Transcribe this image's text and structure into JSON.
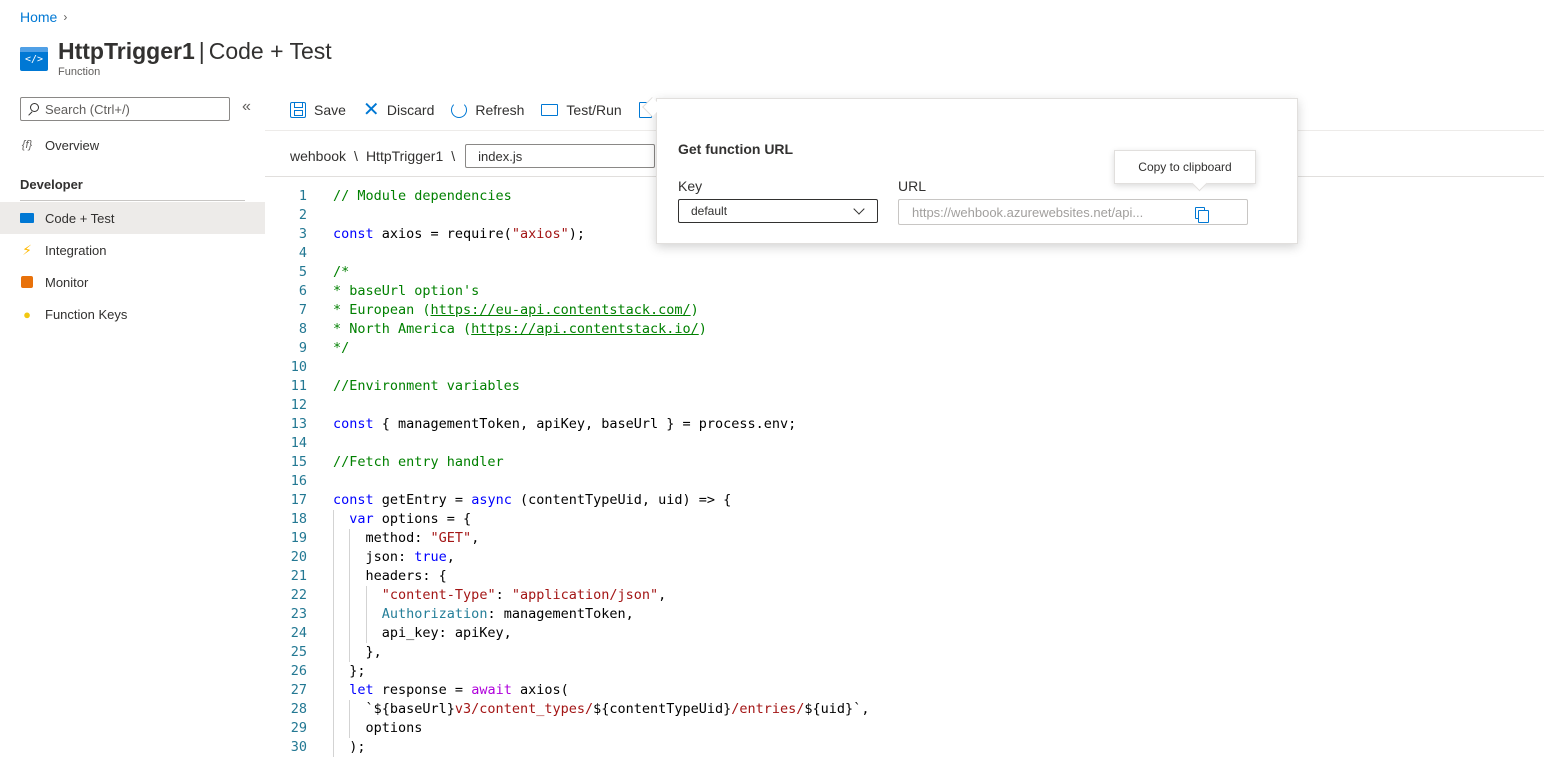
{
  "breadcrumb": {
    "home": "Home",
    "separator": "›"
  },
  "header": {
    "title": "HttpTrigger1",
    "separator": "|",
    "section": "Code + Test",
    "subtitle": "Function",
    "icon_text": "</>"
  },
  "sidebar": {
    "search_placeholder": "Search (Ctrl+/)",
    "collapse": "«",
    "overview": "Overview",
    "section": "Developer",
    "items": [
      {
        "label": "Code + Test",
        "icon": "code-icon"
      },
      {
        "label": "Integration",
        "icon": "lightning-icon"
      },
      {
        "label": "Monitor",
        "icon": "monitor-icon"
      },
      {
        "label": "Function Keys",
        "icon": "key-icon"
      }
    ]
  },
  "toolbar": {
    "save": "Save",
    "discard": "Discard",
    "refresh": "Refresh",
    "test_run": "Test/Run"
  },
  "path": {
    "app": "wehbook",
    "sep": "\\",
    "function": "HttpTrigger1",
    "file": "index.js"
  },
  "popup": {
    "title": "Get function URL",
    "key_label": "Key",
    "key_value": "default",
    "url_label": "URL",
    "url_value": "https://wehbook.azurewebsites.net/api..."
  },
  "tooltip": "Copy to clipboard",
  "colors": {
    "accent": "#0078d4",
    "comment": "#008000",
    "keyword": "#0000ff",
    "string": "#a31515",
    "control": "#af00db",
    "property": "#267f99",
    "line_number": "#237893"
  },
  "editor": {
    "line_numbers": [
      "1",
      "2",
      "3",
      "4",
      "5",
      "6",
      "7",
      "8",
      "9",
      "10",
      "11",
      "12",
      "13",
      "14",
      "15",
      "16",
      "17",
      "18",
      "19",
      "20",
      "21",
      "22",
      "23",
      "24",
      "25",
      "26",
      "27",
      "28",
      "29",
      "30"
    ],
    "lines": [
      [
        [
          "c",
          "// Module dependencies"
        ]
      ],
      [],
      [
        [
          "k",
          "const"
        ],
        [
          "t",
          " axios = require("
        ],
        [
          "s",
          "\"axios\""
        ],
        [
          "t",
          ");"
        ]
      ],
      [],
      [
        [
          "c",
          "/*"
        ]
      ],
      [
        [
          "c",
          "* baseUrl option's"
        ]
      ],
      [
        [
          "c",
          "* European ("
        ],
        [
          "u",
          "https://eu-api.contentstack.com/"
        ],
        [
          "c",
          ")"
        ]
      ],
      [
        [
          "c",
          "* North America ("
        ],
        [
          "u",
          "https://api.contentstack.io/"
        ],
        [
          "c",
          ")"
        ]
      ],
      [
        [
          "c",
          "*/"
        ]
      ],
      [],
      [
        [
          "c",
          "//Environment variables"
        ]
      ],
      [],
      [
        [
          "k",
          "const"
        ],
        [
          "t",
          " { managementToken, apiKey, baseUrl } = process.env;"
        ]
      ],
      [],
      [
        [
          "c",
          "//Fetch entry handler"
        ]
      ],
      [],
      [
        [
          "k",
          "const"
        ],
        [
          "t",
          " getEntry = "
        ],
        [
          "k",
          "async"
        ],
        [
          "t",
          " (contentTypeUid, uid) => {"
        ]
      ],
      [
        [
          "t",
          "  "
        ],
        [
          "k",
          "var"
        ],
        [
          "t",
          " options = {"
        ]
      ],
      [
        [
          "t",
          "    method: "
        ],
        [
          "s",
          "\"GET\""
        ],
        [
          "t",
          ","
        ]
      ],
      [
        [
          "t",
          "    json: "
        ],
        [
          "k",
          "true"
        ],
        [
          "t",
          ","
        ]
      ],
      [
        [
          "t",
          "    headers: {"
        ]
      ],
      [
        [
          "t",
          "      "
        ],
        [
          "s",
          "\"content-Type\""
        ],
        [
          "t",
          ": "
        ],
        [
          "s",
          "\"application/json\""
        ],
        [
          "t",
          ","
        ]
      ],
      [
        [
          "t",
          "      "
        ],
        [
          "p",
          "Authorization"
        ],
        [
          "t",
          ": managementToken,"
        ]
      ],
      [
        [
          "t",
          "      api_key: apiKey,"
        ]
      ],
      [
        [
          "t",
          "    },"
        ]
      ],
      [
        [
          "t",
          "  };"
        ]
      ],
      [
        [
          "t",
          "  "
        ],
        [
          "k",
          "let"
        ],
        [
          "t",
          " response = "
        ],
        [
          "x",
          "await"
        ],
        [
          "t",
          " axios("
        ]
      ],
      [
        [
          "t",
          "    `${baseUrl}"
        ],
        [
          "s",
          "v3/content_types/"
        ],
        [
          "t",
          "${contentTypeUid}"
        ],
        [
          "s",
          "/entries/"
        ],
        [
          "t",
          "${uid}`,"
        ]
      ],
      [
        [
          "t",
          "    options"
        ]
      ],
      [
        [
          "t",
          "  );"
        ]
      ]
    ]
  }
}
